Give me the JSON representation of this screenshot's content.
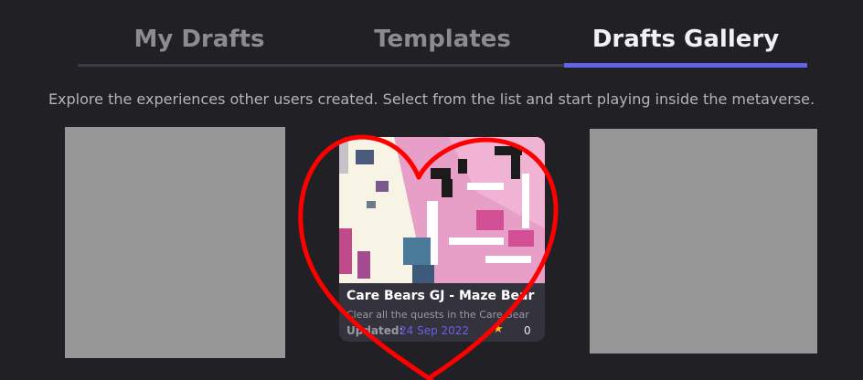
{
  "tabs": [
    {
      "label": "My Drafts",
      "active": false
    },
    {
      "label": "Templates",
      "active": false
    },
    {
      "label": "Drafts Gallery",
      "active": true
    }
  ],
  "subtitle": "Explore the experiences other users created. Select from the list and start playing inside the metaverse.",
  "cards": [
    {
      "title": "Care Bears GJ - Maze Bear",
      "description": "Clear all the quests in the Care Bear",
      "updated_label": "Updated:",
      "updated_date": "24 Sep 2022",
      "likes": "0"
    }
  ],
  "colors": {
    "background": "#212024",
    "accent": "#6262ea",
    "placeholder": "#979797",
    "annotation": "#ff0000"
  },
  "icons": [
    "star-icon",
    "heart-annotation"
  ]
}
